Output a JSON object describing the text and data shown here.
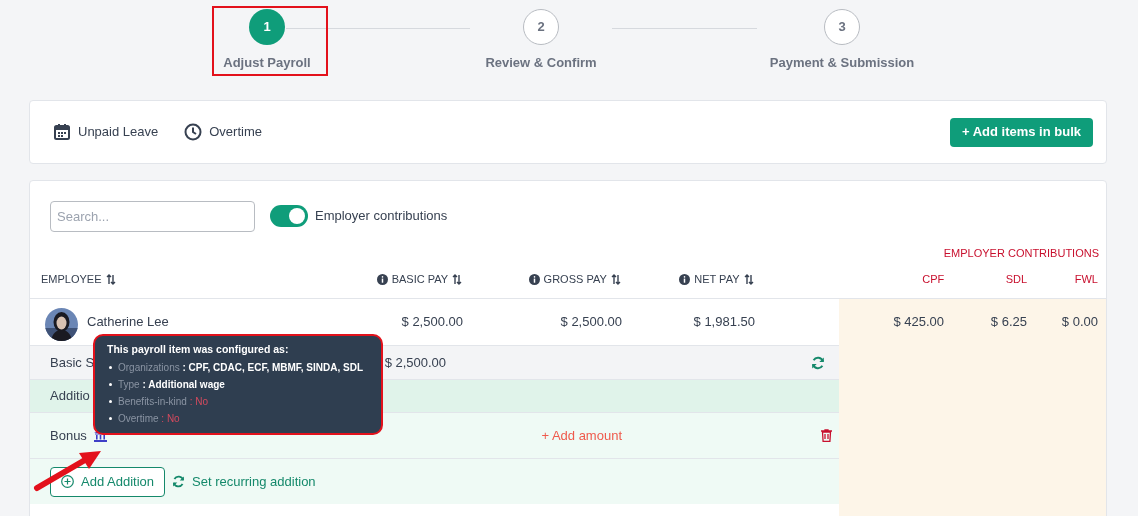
{
  "stepper": {
    "steps": [
      {
        "number": "1",
        "label": "Adjust Payroll",
        "selected": true
      },
      {
        "number": "2",
        "label": "Review & Confirm",
        "selected": false
      },
      {
        "number": "3",
        "label": "Payment & Submission",
        "selected": false
      }
    ]
  },
  "toolbar": {
    "items": [
      {
        "label": "Unpaid Leave",
        "kind": "calendar"
      },
      {
        "label": "Overtime",
        "kind": "clock"
      }
    ],
    "bulk_button": "+ Add items in bulk"
  },
  "filters": {
    "search": {
      "placeholder": "Search..."
    },
    "toggle": {
      "label": "Employer contributions",
      "on": true
    }
  },
  "table": {
    "group_heading": "EMPLOYER CONTRIBUTIONS",
    "columns": [
      {
        "label": "EMPLOYEE",
        "kind": "pay",
        "info": false,
        "sortable": true
      },
      {
        "label": "BASIC PAY",
        "kind": "pay",
        "info": true,
        "sortable": true
      },
      {
        "label": "GROSS PAY",
        "kind": "pay",
        "info": true,
        "sortable": true
      },
      {
        "label": "NET PAY",
        "kind": "pay",
        "info": true,
        "sortable": true
      },
      {
        "label": "CPF",
        "kind": "contribution",
        "info": false,
        "sortable": false
      },
      {
        "label": "SDL",
        "kind": "contribution",
        "info": false,
        "sortable": false
      },
      {
        "label": "FWL",
        "kind": "contribution",
        "info": false,
        "sortable": false
      }
    ],
    "employee": {
      "name": "Catherine Lee",
      "values": [
        "$ 2,500.00",
        "$ 2,500.00",
        "$ 1,981.50",
        "$ 425.00",
        "$ 6.25",
        "$ 0.00"
      ]
    },
    "basic_row": {
      "label": "Basic S",
      "amount": "$ 2,500.00"
    },
    "additions_heading": "Additio",
    "items": [
      {
        "label": "Bonus",
        "action": "+ Add amount"
      }
    ],
    "add_button": "Add Addition",
    "recurring_link": "Set recurring addition"
  },
  "tooltip": {
    "title": "This payroll item was configured as:",
    "lines": [
      {
        "key": "Organizations",
        "value": ": CPF, CDAC, ECF, MBMF, SINDA, SDL",
        "kind": "plain"
      },
      {
        "key": "Type",
        "value": ": Additional wage",
        "kind": "plain"
      },
      {
        "key": "Benefits-in-kind",
        "value": ": No",
        "kind": "negative"
      },
      {
        "key": "Overtime",
        "value": ": No",
        "kind": "negative"
      }
    ]
  }
}
